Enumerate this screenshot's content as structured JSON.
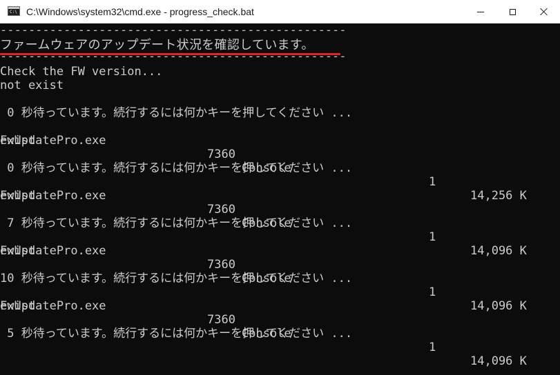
{
  "window": {
    "title": "C:\\Windows\\system32\\cmd.exe - progress_check.bat",
    "icon": "cmd-icon"
  },
  "console": {
    "separator": "------------------------------------------------------------",
    "heading": "ファームウェアのアップデート状況を確認しています。",
    "check_line": "Check the FW version...",
    "status_first": "not exist",
    "blocks": [
      {
        "wait": " 0 秒待っています。続行するには何かキーを押してください ...",
        "process": {
          "name": "FwUpdatePro.exe",
          "pid": "7360",
          "session": "Console",
          "num": "1",
          "mem": "14,256 K"
        },
        "status": "exist"
      },
      {
        "wait": " 0 秒待っています。続行するには何かキーを押してください ...",
        "process": {
          "name": "FwUpdatePro.exe",
          "pid": "7360",
          "session": "Console",
          "num": "1",
          "mem": "14,096 K"
        },
        "status": "exist"
      },
      {
        "wait": " 7 秒待っています。続行するには何かキーを押してください ...",
        "process": {
          "name": "FwUpdatePro.exe",
          "pid": "7360",
          "session": "Console",
          "num": "1",
          "mem": "14,096 K"
        },
        "status": "exist"
      },
      {
        "wait": "10 秒待っています。続行するには何かキーを押してください ...",
        "process": {
          "name": "FwUpdatePro.exe",
          "pid": "7360",
          "session": "Console",
          "num": "1",
          "mem": "14,096 K"
        },
        "status": "exist"
      }
    ],
    "final_wait": " 5 秒待っています。続行するには何かキーを押してください ..."
  },
  "colors": {
    "background": "#0c0c0c",
    "text": "#cccccc",
    "underline": "#e6202a"
  }
}
